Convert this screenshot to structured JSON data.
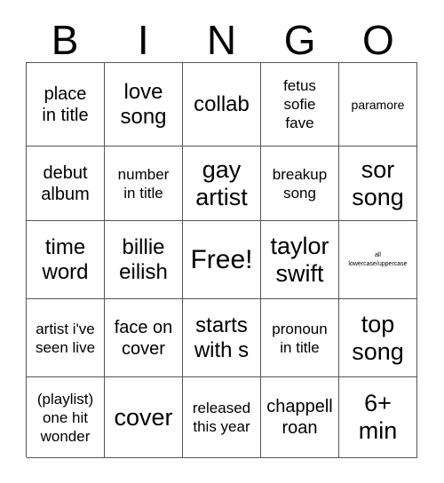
{
  "card": {
    "title": "BINGO",
    "header_letters": [
      "B",
      "I",
      "N",
      "G",
      "O"
    ],
    "free_space_label": "Free!",
    "grid_line_color": "#555555",
    "text_color": "#000000",
    "background_color": "#ffffff",
    "rows": 5,
    "columns": 5
  },
  "cells": [
    {
      "text": "place\nin title",
      "size": "md"
    },
    {
      "text": "love\nsong",
      "size": "lg"
    },
    {
      "text": "collab",
      "size": "lg"
    },
    {
      "text": "fetus\nsofie\nfave",
      "size": "sm"
    },
    {
      "text": "paramore",
      "size": "xs"
    },
    {
      "text": "debut\nalbum",
      "size": "md"
    },
    {
      "text": "number\nin title",
      "size": "sm"
    },
    {
      "text": "gay\nartist",
      "size": "xl"
    },
    {
      "text": "breakup\nsong",
      "size": "sm"
    },
    {
      "text": "sor\nsong",
      "size": "xl"
    },
    {
      "text": "time\nword",
      "size": "lg"
    },
    {
      "text": "billie\neilish",
      "size": "lg"
    },
    {
      "text": "Free!",
      "size": "xxl"
    },
    {
      "text": "taylor\nswift",
      "size": "xl"
    },
    {
      "text": "all\nlowercase/uppercase",
      "size": "tiny"
    },
    {
      "text": "artist i've\nseen live",
      "size": "sm"
    },
    {
      "text": "face on\ncover",
      "size": "md"
    },
    {
      "text": "starts\nwith s",
      "size": "lg"
    },
    {
      "text": "pronoun\nin title",
      "size": "sm"
    },
    {
      "text": "top\nsong",
      "size": "xl"
    },
    {
      "text": "(playlist)\none hit\nwonder",
      "size": "sm"
    },
    {
      "text": "cover",
      "size": "xl"
    },
    {
      "text": "released\nthis year",
      "size": "sm"
    },
    {
      "text": "chappell\nroan",
      "size": "md"
    },
    {
      "text": "6+\nmin",
      "size": "xl"
    }
  ]
}
